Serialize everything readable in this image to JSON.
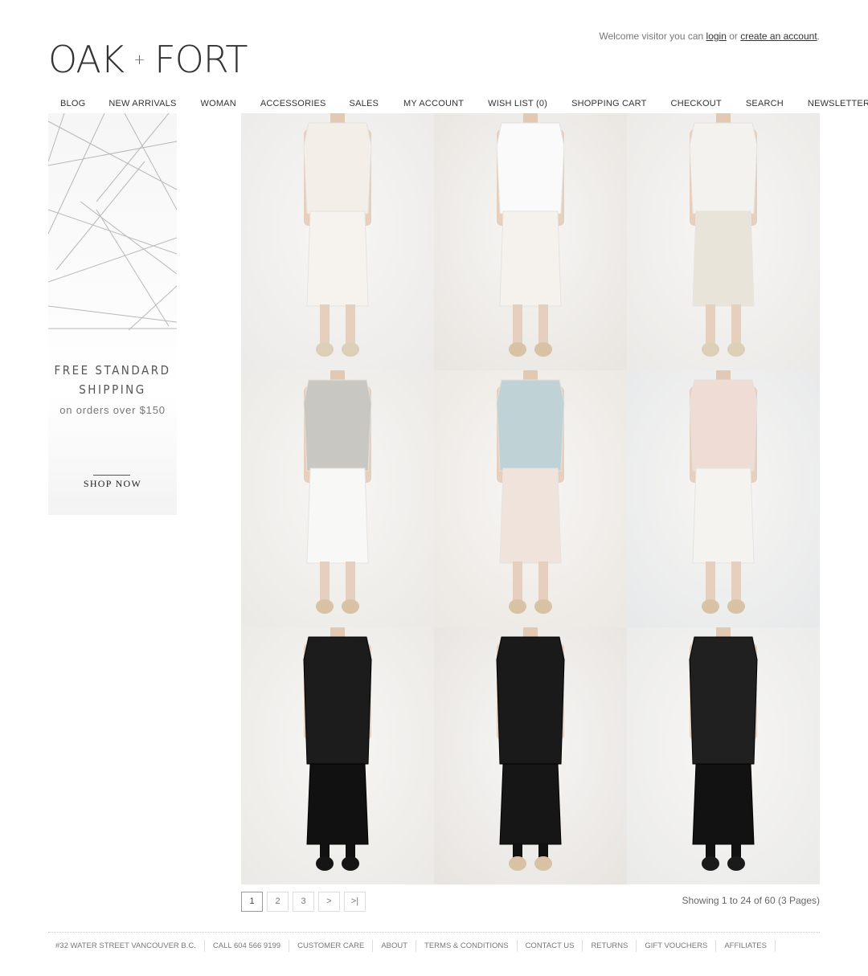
{
  "header": {
    "welcome_text": "Welcome visitor you can",
    "login_label": "login",
    "or_text": "or",
    "create_account_label": "create an account",
    "period": ".",
    "logo_left": "OAK",
    "logo_plus": "+",
    "logo_right": "FORT"
  },
  "nav": [
    {
      "label": "BLOG"
    },
    {
      "label": "NEW ARRIVALS"
    },
    {
      "label": "WOMAN"
    },
    {
      "label": "ACCESSORIES"
    },
    {
      "label": "SALES"
    },
    {
      "label": "MY ACCOUNT"
    },
    {
      "label": "WISH LIST (0)"
    },
    {
      "label": "SHOPPING CART"
    },
    {
      "label": "CHECKOUT"
    },
    {
      "label": "SEARCH"
    },
    {
      "label": "NEWSLETTER"
    }
  ],
  "promo": {
    "line1": "FREE STANDARD",
    "line2": "SHIPPING",
    "orders": "on orders over $150",
    "shop_now": "SHOP NOW"
  },
  "products": [
    {
      "top": "#f3efe8",
      "bottom": "#f6f3ee",
      "shoes": "#ddd0b8",
      "bg": "#ecebe9",
      "outfit": "white-lace-dress"
    },
    {
      "top": "#fafafa",
      "bottom": "#f5f2ee",
      "shoes": "#d8c2a6",
      "bg": "#e9e6e1",
      "outfit": "white-tee-pleated-skirt"
    },
    {
      "top": "#f4f2ee",
      "bottom": "#e9e4d9",
      "shoes": "#ddd0b8",
      "bg": "#eceae7",
      "outfit": "white-tunic-dress"
    },
    {
      "top": "#c9c7c2",
      "bottom": "#f8f8f6",
      "shoes": "#d8c2a6",
      "bg": "#eceae6",
      "outfit": "grey-blazer-white-dress"
    },
    {
      "top": "#bfd2d6",
      "bottom": "#efe3dc",
      "shoes": "#d8c2a6",
      "bg": "#ece8e3",
      "outfit": "mint-shirt-dress"
    },
    {
      "top": "#efdcd5",
      "bottom": "#f5f3f0",
      "shoes": "#d8c2a6",
      "bg": "#e8e9ea",
      "outfit": "blush-sheer-top"
    },
    {
      "top": "#1c1c1c",
      "bottom": "#111111",
      "shoes": "#151515",
      "bg": "#eceae6",
      "outfit": "black-drape-cardigan"
    },
    {
      "top": "#1a1a1a",
      "bottom": "#161616",
      "shoes": "#d8c2a6",
      "bg": "#e8e5e1",
      "outfit": "black-drape-vest"
    },
    {
      "top": "#202020",
      "bottom": "#121212",
      "shoes": "#1a1a1a",
      "bg": "#ebebea",
      "outfit": "black-sheer-shirt"
    }
  ],
  "pagination": {
    "pages": [
      "1",
      "2",
      "3"
    ],
    "next": ">",
    "last": ">|",
    "current": "1"
  },
  "showing": "Showing 1 to 24 of 60 (3 Pages)",
  "footer": [
    {
      "label": "#32 WATER STREET VANCOUVER B.C."
    },
    {
      "label": "CALL 604 566 9199"
    },
    {
      "label": "CUSTOMER CARE"
    },
    {
      "label": "ABOUT"
    },
    {
      "label": "TERMS & CONDITIONS"
    },
    {
      "label": "CONTACT US"
    },
    {
      "label": "RETURNS"
    },
    {
      "label": "GIFT VOUCHERS"
    },
    {
      "label": "AFFILIATES"
    }
  ]
}
